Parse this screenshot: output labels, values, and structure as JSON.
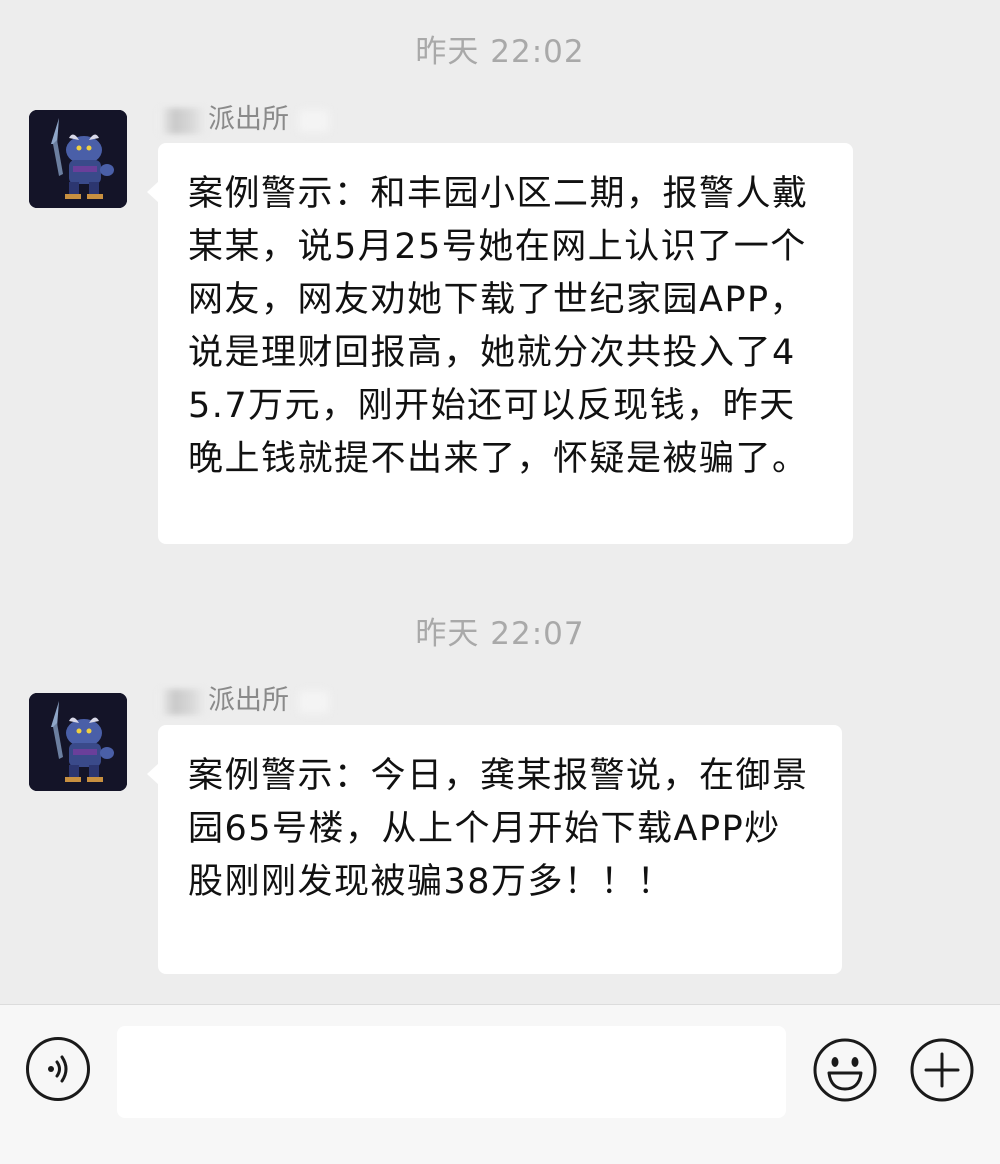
{
  "messages": [
    {
      "timestamp": "昨天 22:02",
      "sender": "派出所",
      "text": "案例警示：和丰园小区二期，报警人戴某某，说5月25号她在网上认识了一个网友，网友劝她下载了世纪家园APP，说是理财回报高，她就分次共投入了45.7万元，刚开始还可以反现钱，昨天晚上钱就提不出来了，怀疑是被骗了。"
    },
    {
      "timestamp": "昨天 22:07",
      "sender": "派出所",
      "text": "案例警示：今日，龚某报警说，在御景园65号楼，从上个月开始下载APP炒股刚刚发现被骗38万多！！！"
    }
  ],
  "input_bar": {
    "voice_icon": "voice-icon",
    "emoji_icon": "emoji-icon",
    "plus_icon": "plus-icon"
  },
  "colors": {
    "chat_background": "#ededed",
    "bubble": "#ffffff",
    "timestamp_text": "#a9a9a9",
    "sender_text": "#8a8a8a",
    "message_text": "#111111"
  }
}
